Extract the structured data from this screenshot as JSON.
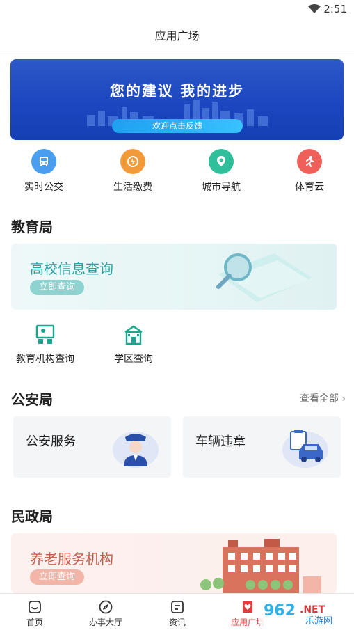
{
  "status": {
    "time": "2:51"
  },
  "header": {
    "title": "应用广场"
  },
  "banner": {
    "title": "您的建议 我的进步",
    "cta": "欢迎点击反馈"
  },
  "quick_services": [
    {
      "label": "实时公交",
      "icon": "bus-icon",
      "color": "#4a9ef0"
    },
    {
      "label": "生活缴费",
      "icon": "payment-icon",
      "color": "#f29a3a"
    },
    {
      "label": "城市导航",
      "icon": "map-pin-icon",
      "color": "#2fbf9b"
    },
    {
      "label": "体育云",
      "icon": "runner-icon",
      "color": "#f0605a"
    }
  ],
  "education": {
    "title": "教育局",
    "card": {
      "title": "高校信息查询",
      "button": "立即查询"
    },
    "items": [
      {
        "label": "教育机构查询",
        "icon": "classroom-icon"
      },
      {
        "label": "学区查询",
        "icon": "school-building-icon"
      }
    ]
  },
  "police": {
    "title": "公安局",
    "see_all": "查看全部",
    "cards": [
      {
        "label": "公安服务",
        "icon": "police-officer-icon"
      },
      {
        "label": "车辆违章",
        "icon": "car-violation-icon"
      }
    ]
  },
  "civil": {
    "title": "民政局",
    "card": {
      "title": "养老服务机构",
      "button": "立即查询"
    }
  },
  "tabs": [
    {
      "label": "首页",
      "icon": "home-icon",
      "active": false
    },
    {
      "label": "办事大厅",
      "icon": "compass-icon",
      "active": false
    },
    {
      "label": "资讯",
      "icon": "news-icon",
      "active": false
    },
    {
      "label": "应用广场",
      "icon": "apps-heart-icon",
      "active": true
    }
  ],
  "watermark": {
    "text": "962.NET",
    "sub": "乐游网"
  },
  "colors": {
    "accent": "#e23c3c",
    "teal": "#2aa3a3",
    "banner": "#1b47c0"
  }
}
